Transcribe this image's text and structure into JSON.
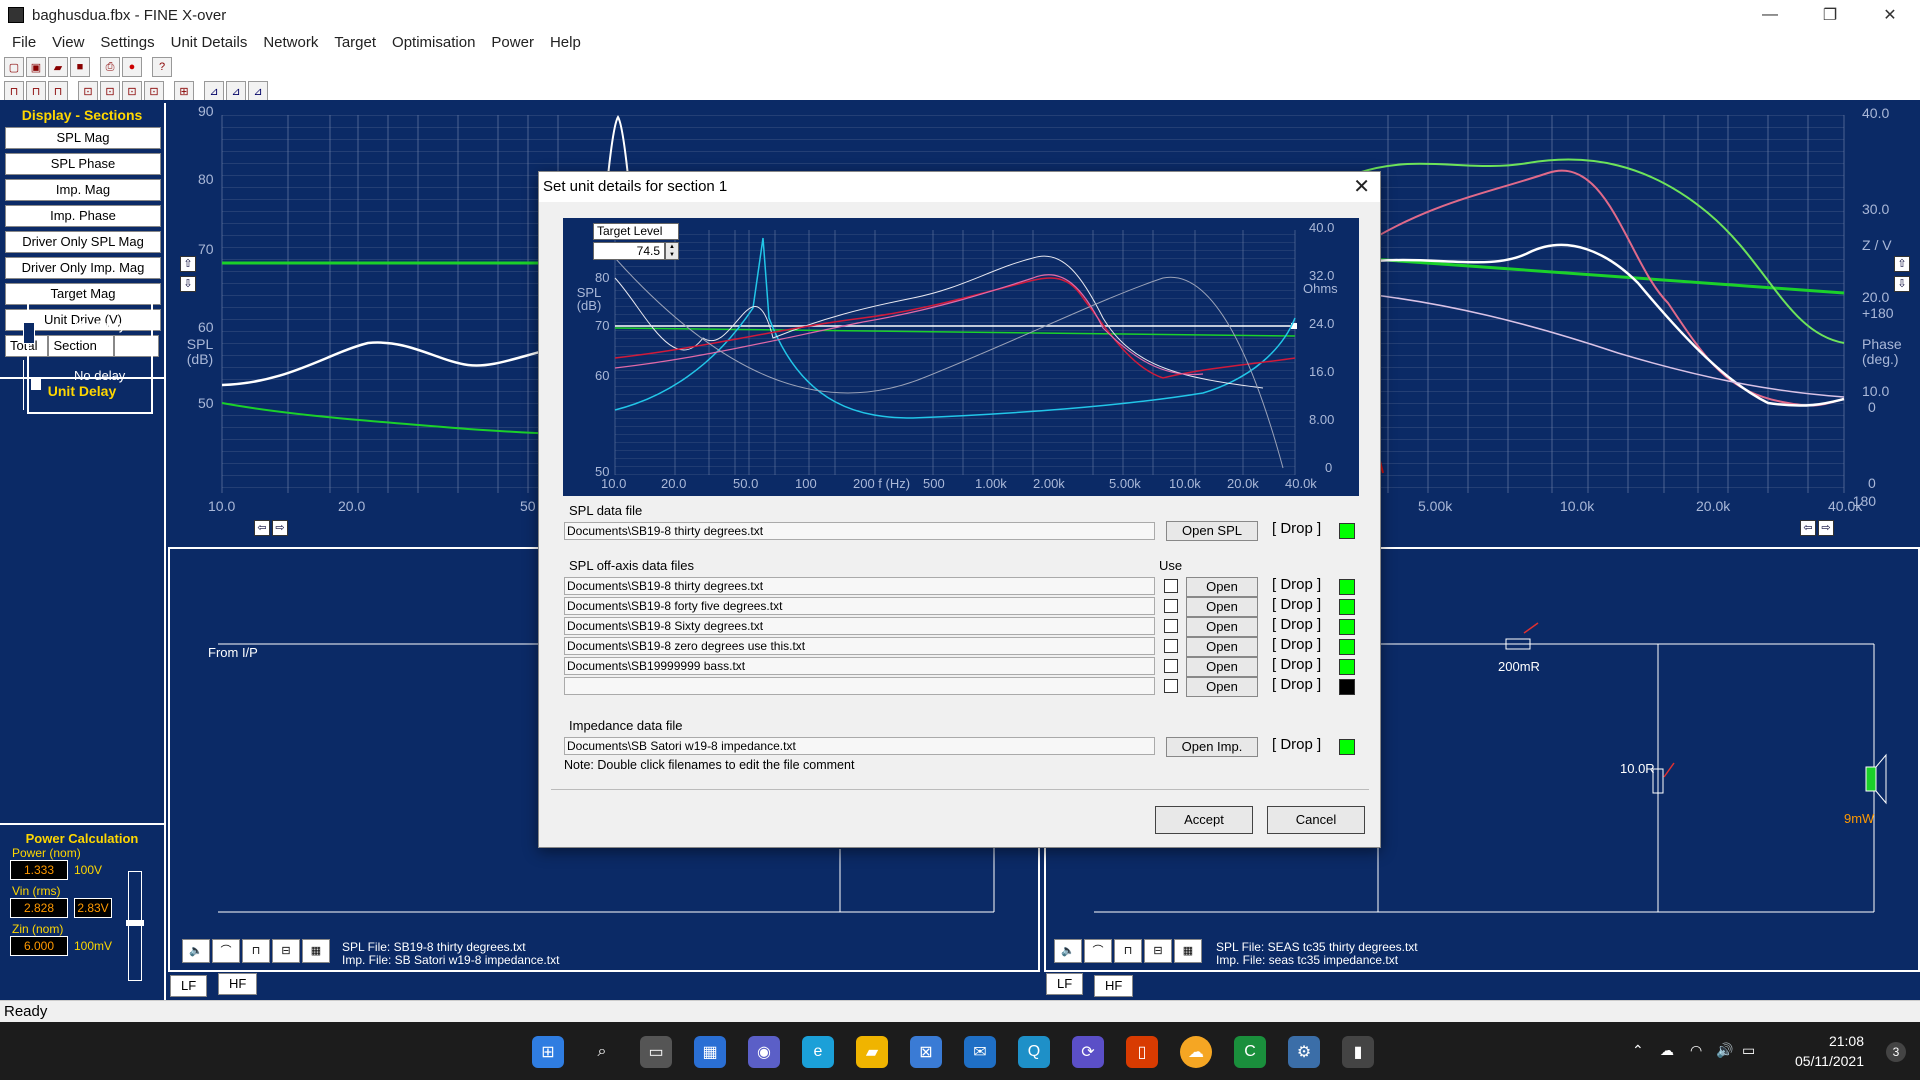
{
  "window": {
    "title": "baghusdua.fbx - FINE X-over",
    "min": "—",
    "restore": "❐",
    "close": "✕"
  },
  "menus": [
    "File",
    "View",
    "Settings",
    "Unit Details",
    "Network",
    "Target",
    "Optimisation",
    "Power",
    "Help"
  ],
  "left_panel": {
    "display_heading": "Display - Sections",
    "buttons": [
      "SPL Mag",
      "SPL Phase",
      "Imp. Mag",
      "Imp. Phase",
      "Driver Only SPL Mag",
      "Driver Only Imp. Mag",
      "Target Mag",
      "Unit Drive (V)"
    ],
    "tabs": [
      "Total",
      "Section"
    ],
    "unit_delay_heading": "Unit Delay",
    "delays": [
      "No delay",
      "No delay"
    ],
    "power_heading": "Power Calculation",
    "power_nom_label": "Power (nom)",
    "power_nom_value": "1.333",
    "power_nom_unit": "100V",
    "vin_label": "Vin (rms)",
    "vin_value": "2.828",
    "vin_box": "2.83V",
    "zin_label": "Zin (nom)",
    "zin_value": "6.000",
    "zin_unit": "100mV"
  },
  "main_graph": {
    "left_axis_label": "SPL (dB)",
    "right_axis_labels": [
      "Z / V",
      "Phase (deg.)"
    ],
    "y_ticks": [
      "90",
      "80",
      "70",
      "60",
      "50"
    ],
    "x_ticks_left": [
      "10.0",
      "20.0",
      "50"
    ],
    "x_ticks_right": [
      "5.00k",
      "10.0k",
      "20.0k",
      "40.0k"
    ],
    "right_ticks": [
      "40.0",
      "30.0",
      "20.0 +180",
      "10.0",
      "0",
      "0 -180"
    ],
    "right_ticks_top": "40.0",
    "r30": "30.0",
    "r20": "20.0",
    "r180": "+180",
    "r10": "10.0",
    "r0a": "0",
    "r0b": "0",
    "rm180": "-180"
  },
  "circuit_left": {
    "from_label": "From I/P",
    "spl_file": "SPL File: SB19-8 thirty degrees.txt",
    "imp_file": "Imp. File: SB Satori w19-8 impedance.txt",
    "tabs": [
      "LF",
      "HF"
    ]
  },
  "circuit_right": {
    "r1": "200mR",
    "r2": "10.0R",
    "power": "9mW",
    "spl_file": "SPL File: SEAS tc35 thirty degrees.txt",
    "imp_file": "Imp. File: seas tc35 impedance.txt",
    "tabs": [
      "LF",
      "HF"
    ]
  },
  "status": {
    "text": "Ready"
  },
  "clock": {
    "time": "21:08",
    "date": "05/11/2021",
    "notifications": "3"
  },
  "dialog": {
    "title": "Set unit details for section 1",
    "chart": {
      "target_label": "Target Level",
      "target_value": "74.5",
      "spl_label": "SPL (dB)",
      "ohms_label": "Ohms",
      "y_left": [
        "80",
        "70",
        "60",
        "50"
      ],
      "y_right": [
        "40.0",
        "32.0",
        "24.0",
        "16.0",
        "8.00",
        "0"
      ],
      "x_ticks": [
        "10.0",
        "20.0",
        "50.0",
        "100",
        "200 f (Hz)",
        "500",
        "1.00k",
        "2.00k",
        "5.00k",
        "10.0k",
        "20.0k",
        "40.0k"
      ]
    },
    "spl_data_label": "SPL data file",
    "spl_data_file": "Documents\\SB19-8 thirty degrees.txt",
    "open_spl": "Open SPL",
    "drop": "[ Drop ]",
    "off_axis_label": "SPL off-axis data files",
    "use_label": "Use",
    "off_axis_files": [
      "Documents\\SB19-8 thirty degrees.txt",
      "Documents\\SB19-8 forty five degrees.txt",
      "Documents\\SB19-8 Sixty degrees.txt",
      "Documents\\SB19-8 zero degrees use this.txt",
      "Documents\\SB19999999 bass.txt",
      ""
    ],
    "open": "Open",
    "impedance_label": "Impedance data file",
    "impedance_file": "Documents\\SB Satori w19-8 impedance.txt",
    "open_imp": "Open Imp.",
    "note": "Note: Double click filenames to edit the file comment",
    "accept": "Accept",
    "cancel": "Cancel",
    "colors": {
      "green": "#00ff00",
      "black": "#000000"
    }
  },
  "colors": {
    "workspace": "#0b2a66",
    "accent_yellow": "#ffd700",
    "power_orange": "#ff9900"
  }
}
